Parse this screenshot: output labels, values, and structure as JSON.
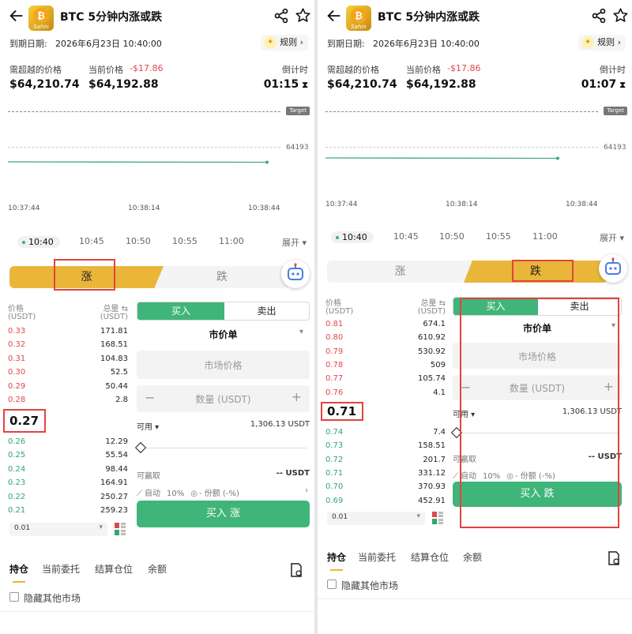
{
  "left": {
    "title": "BTC 5分钟内涨或跌",
    "logo_text": "Sahin",
    "expiry_label": "到期日期:",
    "expiry_value": "2026年6月23日 10:40:00",
    "rules_label": "规则 ›",
    "target_label": "需超越的价格",
    "target_value": "$64,210.74",
    "current_label": "当前价格",
    "current_change": "-$17.86",
    "current_value": "$64,192.88",
    "countdown_label": "倒计时",
    "countdown_value": "01:15",
    "chart_tag": "Target",
    "chart_price_label": "64193",
    "chart_times": [
      "10:37:44",
      "10:38:14",
      "10:38:44"
    ],
    "timeline": [
      "10:40",
      "10:45",
      "10:50",
      "10:55",
      "11:00"
    ],
    "expand": "展开 ▾",
    "tab_up": "涨",
    "tab_down": "跌",
    "book_price_header": "价格",
    "book_price_unit": "(USDT)",
    "book_qty_header": "总量 ⇆",
    "book_qty_unit": "(USDT)",
    "asks": [
      {
        "p": "0.33",
        "q": "171.81"
      },
      {
        "p": "0.32",
        "q": "168.51"
      },
      {
        "p": "0.31",
        "q": "104.83"
      },
      {
        "p": "0.30",
        "q": "52.5"
      },
      {
        "p": "0.29",
        "q": "50.44"
      },
      {
        "p": "0.28",
        "q": "2.8"
      }
    ],
    "last": "0.27",
    "bids": [
      {
        "p": "0.26",
        "q": "12.29"
      },
      {
        "p": "0.25",
        "q": "55.54"
      },
      {
        "p": "0.24",
        "q": "98.44"
      },
      {
        "p": "0.23",
        "q": "164.91"
      },
      {
        "p": "0.22",
        "q": "250.27"
      },
      {
        "p": "0.21",
        "q": "259.23"
      }
    ],
    "precision": "0.01",
    "buy_label": "买入",
    "sell_label": "卖出",
    "order_type": "市价单",
    "market_price": "市场价格",
    "qty_placeholder": "数量 (USDT)",
    "minus": "−",
    "plus": "+",
    "available_label": "可用 ▾",
    "available_value": "1,306.13 USDT",
    "winnable_label": "可赢取",
    "winnable_value": "-- USDT",
    "auto_label": "自动",
    "auto_pct": "10%",
    "share_label": "- 份额 (-%)",
    "buy_button": "买入 涨",
    "bottom_tabs": [
      "持仓",
      "当前委托",
      "结算仓位",
      "余额"
    ],
    "hide_markets": "隐藏其他市场"
  },
  "right": {
    "title": "BTC 5分钟内涨或跌",
    "logo_text": "Sahin",
    "expiry_label": "到期日期:",
    "expiry_value": "2026年6月23日 10:40:00",
    "rules_label": "规则 ›",
    "target_label": "需超越的价格",
    "target_value": "$64,210.74",
    "current_label": "当前价格",
    "current_change": "-$17.86",
    "current_value": "$64,192.88",
    "countdown_label": "倒计时",
    "countdown_value": "01:07",
    "chart_tag": "Target",
    "chart_price_label": "64193",
    "chart_times": [
      "10:37:44",
      "10:38:14",
      "10:38:44"
    ],
    "timeline": [
      "10:40",
      "10:45",
      "10:50",
      "10:55",
      "11:00"
    ],
    "expand": "展开 ▾",
    "tab_up": "涨",
    "tab_down": "跌",
    "book_price_header": "价格",
    "book_price_unit": "(USDT)",
    "book_qty_header": "总量 ⇆",
    "book_qty_unit": "(USDT)",
    "asks": [
      {
        "p": "0.81",
        "q": "674.1"
      },
      {
        "p": "0.80",
        "q": "610.92"
      },
      {
        "p": "0.79",
        "q": "530.92"
      },
      {
        "p": "0.78",
        "q": "509"
      },
      {
        "p": "0.77",
        "q": "105.74"
      },
      {
        "p": "0.76",
        "q": "4.1"
      }
    ],
    "last": "0.71",
    "bids": [
      {
        "p": "0.74",
        "q": "7.4"
      },
      {
        "p": "0.73",
        "q": "158.51"
      },
      {
        "p": "0.72",
        "q": "201.7"
      },
      {
        "p": "0.71",
        "q": "331.12"
      },
      {
        "p": "0.70",
        "q": "370.93"
      },
      {
        "p": "0.69",
        "q": "452.91"
      }
    ],
    "precision": "0.01",
    "buy_label": "买入",
    "sell_label": "卖出",
    "order_type": "市价单",
    "market_price": "市场价格",
    "qty_placeholder": "数量 (USDT)",
    "minus": "−",
    "plus": "+",
    "available_label": "可用 ▾",
    "available_value": "1,306.13 USDT",
    "winnable_label": "可赢取",
    "winnable_value": "-- USDT",
    "auto_label": "自动",
    "auto_pct": "10%",
    "share_label": "- 份额 (-%)",
    "buy_button": "买入 跌",
    "bottom_tabs": [
      "持仓",
      "当前委托",
      "结算仓位",
      "余额"
    ],
    "hide_markets": "隐藏其他市场"
  },
  "colors": {
    "accent_green": "#3fb57a",
    "ask_red": "#e0474d",
    "bid_green": "#33a56f",
    "tab_gold": "#e9b63a",
    "highlight_red": "#e2433f"
  },
  "icons": [
    "back-arrow-icon",
    "share-icon",
    "star-icon",
    "lightbulb-icon",
    "robot-icon",
    "hourglass-icon",
    "grid-icon",
    "document-icon",
    "chevron-right-icon"
  ]
}
